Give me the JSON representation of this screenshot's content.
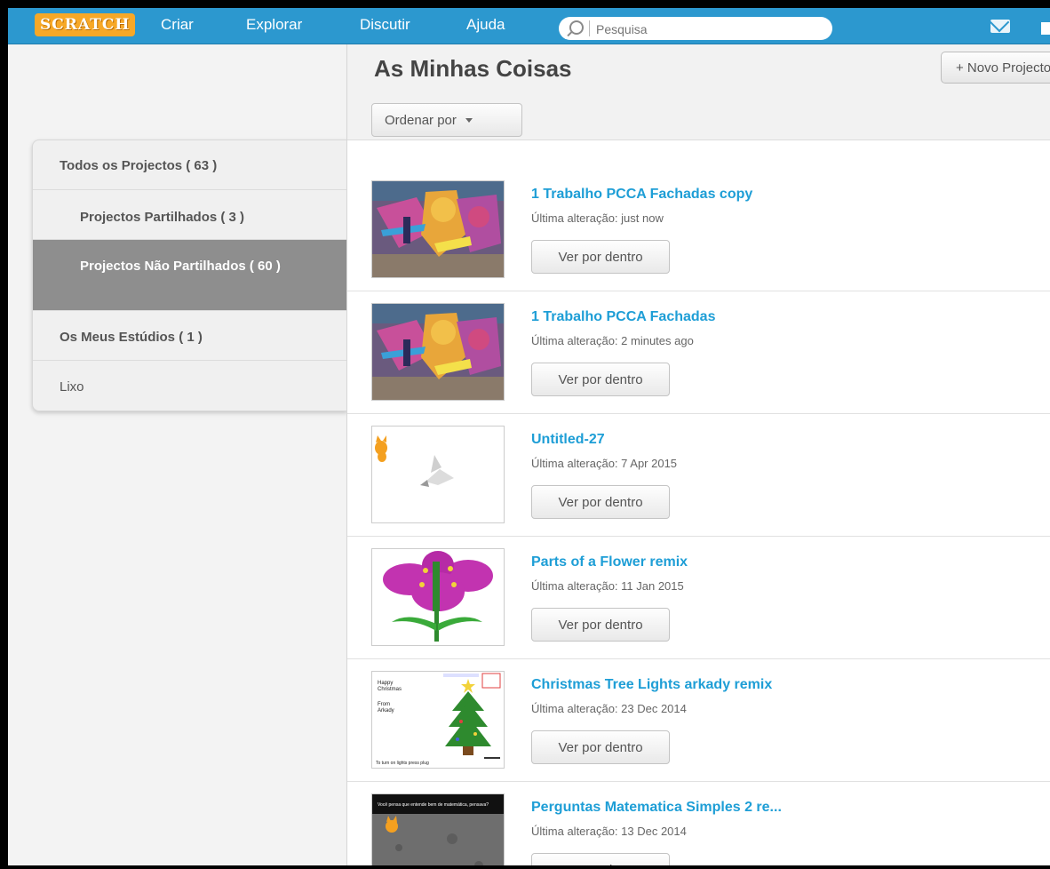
{
  "nav": {
    "logo": "SCRATCH",
    "items": [
      "Criar",
      "Explorar",
      "Discutir",
      "Ajuda"
    ],
    "search_placeholder": "Pesquisa"
  },
  "sidebar": {
    "items": [
      {
        "label": "Todos os Projectos ( 63 )",
        "active": false,
        "indent": false
      },
      {
        "label": "Projectos Partilhados ( 3 )",
        "active": false,
        "indent": true
      },
      {
        "label": "Projectos Não Partilhados ( 60 )",
        "active": true,
        "indent": true
      },
      {
        "label": "Os Meus Estúdios ( 1 )",
        "active": false,
        "indent": false
      },
      {
        "label": "Lixo",
        "active": false,
        "indent": false
      }
    ]
  },
  "main": {
    "title": "As Minhas Coisas",
    "new_project": "+ Novo Projecto",
    "sort_label": "Ordenar por",
    "see_inside_label": "Ver por dentro",
    "projects": [
      {
        "title": "1 Trabalho PCCA Fachadas copy",
        "modified": "Última alteração: just now",
        "thumb": "graffiti"
      },
      {
        "title": "1 Trabalho PCCA Fachadas",
        "modified": "Última alteração: 2 minutes ago",
        "thumb": "graffiti"
      },
      {
        "title": "Untitled-27",
        "modified": "Última alteração: 7 Apr 2015",
        "thumb": "cat-bird"
      },
      {
        "title": "Parts of a Flower remix",
        "modified": "Última alteração: 11 Jan 2015",
        "thumb": "flower"
      },
      {
        "title": "Christmas Tree Lights arkady remix",
        "modified": "Última alteração: 23 Dec 2014",
        "thumb": "tree"
      },
      {
        "title": "Perguntas Matematica Simples 2 re...",
        "modified": "Última alteração: 13 Dec 2014",
        "thumb": "moon"
      }
    ],
    "thumb_text": {
      "tree_left": [
        "Happy",
        "Christmas",
        "From",
        "Arkady"
      ],
      "tree_bottom": "To turn on lights press plug",
      "moon_top": "Você pensa que entende bem de matemática, pensava?"
    }
  },
  "colors": {
    "nav_bg": "#2c98cf",
    "logo_bg": "#f7a827",
    "link": "#1e9ed6",
    "active_item": "#8e8e8e"
  }
}
